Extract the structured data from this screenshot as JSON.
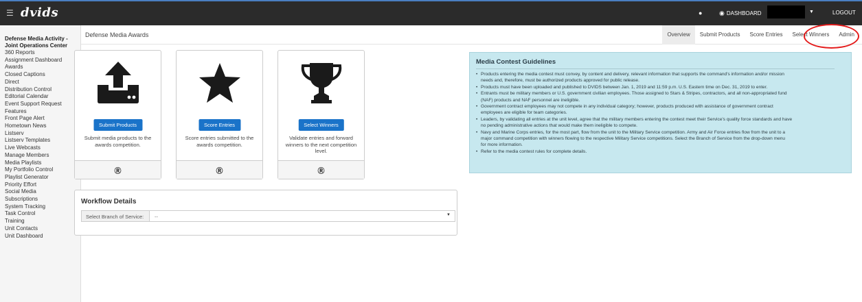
{
  "topbar": {
    "logo": "dvids",
    "dashboard_label": "DASHBOARD",
    "logout_label": "LOGOUT"
  },
  "sidebar": {
    "org": "Defense Media Activity - Joint Operations Center",
    "items": [
      "360 Reports",
      "Assignment Dashboard",
      "Awards",
      "Closed Captions",
      "Direct",
      "Distribution Control",
      "Editorial Calendar",
      "Event Support Request",
      "Features",
      "Front Page Alert",
      "Hometown News",
      "Listserv",
      "Listserv Templates",
      "Live Webcasts",
      "Manage Members",
      "Media Playlists",
      "My Portfolio Control",
      "Playlist Generator",
      "Priority Effort",
      "Social Media",
      "Subscriptions",
      "System Tracking",
      "Task Control",
      "Training",
      "Unit Contacts",
      "Unit Dashboard"
    ]
  },
  "header": {
    "title": "Defense Media Awards",
    "tabs": [
      "Overview",
      "Submit Products",
      "Score Entries",
      "Select Winners",
      "Admin"
    ],
    "active_tab": "Overview"
  },
  "cards": [
    {
      "button": "Submit Products",
      "description": "Submit media products to the awards competition.",
      "footer_icon": "?"
    },
    {
      "button": "Score Entries",
      "description": "Score entries submitted to the awards competition.",
      "footer_icon": "?"
    },
    {
      "button": "Select Winners",
      "description": "Validate entries and forward winners to the next competition level.",
      "footer_icon": "?"
    }
  ],
  "workflow": {
    "title": "Workflow Details",
    "label": "Select Branch of Service:",
    "selected": "--"
  },
  "guidelines": {
    "title": "Media Contest Guidelines",
    "items": [
      "Products entering the media contest must convey, by content and delivery, relevant information that supports the command's information and/or mission",
      "needs and, therefore, must be authorized products approved for public release.",
      "Products must have been uploaded and published to DVIDS between Jan. 1, 2019 and 11:59 p.m. U.S. Eastern time on Dec. 31, 2019 to enter.",
      "Entrants must be military members or U.S. government civilian employees. Those assigned to Stars & Stripes, contractors, and all non-appropriated fund",
      "(NAF) products and NAF personnel are ineligible.",
      "Government contract employees may not compete in any individual category; however, products produced with assistance of government contract",
      "employees are eligible for team categories.",
      "Leaders, by validating all entries at the unit level, agree that the military members entering the contest meet their Service's quality force standards and have",
      "no pending administrative actions that would make them ineligible to compete.",
      "Navy and Marine Corps entries, for the most part, flow from the unit to the Military Service competition. Army and Air Force entries flow from the unit to a",
      "major command competition with winners flowing to the respective Military Service competitions. Select the Branch of Service from the drop-down menu",
      "for more information.",
      "Refer to the media contest rules for complete details."
    ]
  },
  "icons": {
    "menu": "hamburger-icon",
    "chat": "chat-bubble-icon",
    "dashboard": "dashboard-gauge-icon",
    "card1": "upload-icon",
    "card2": "star-icon",
    "card3": "trophy-icon",
    "help": "help-circle-icon"
  },
  "colors": {
    "topbar": "#2b2b2b",
    "primary_button": "#1a73c9",
    "guidelines_bg": "#c7e8ef",
    "annotation": "#e41b1b"
  }
}
